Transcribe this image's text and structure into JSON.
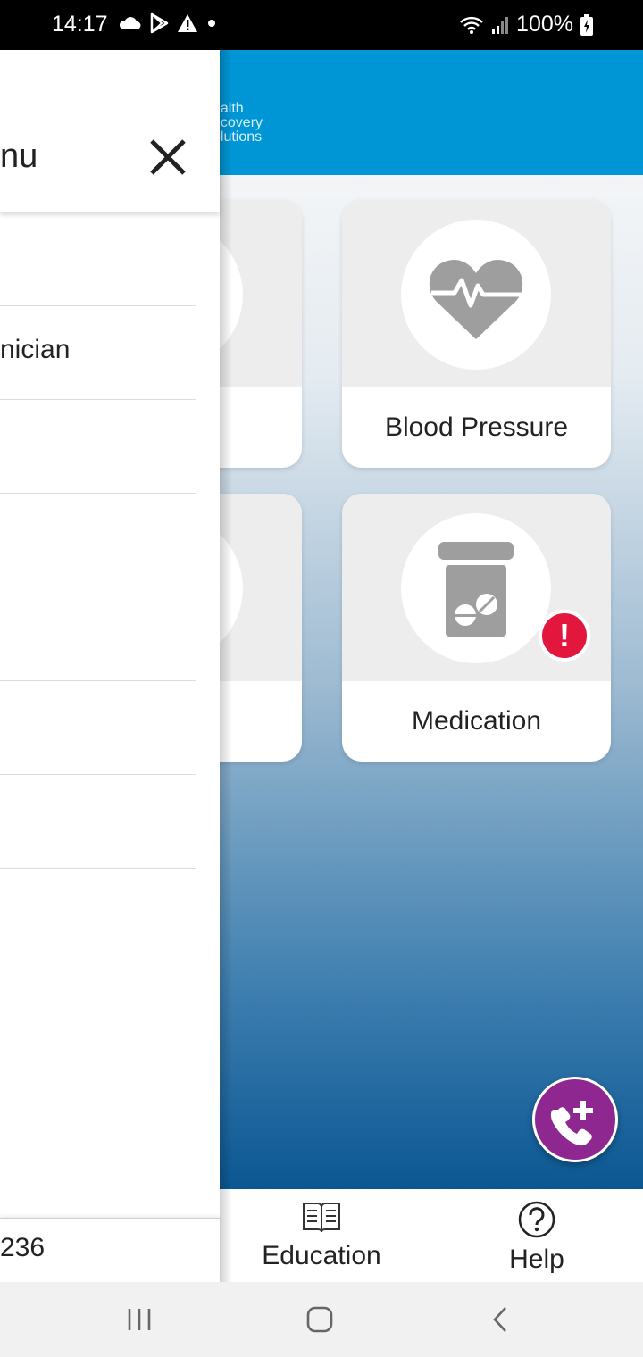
{
  "status_bar": {
    "time": "14:17",
    "battery": "100%",
    "icons": [
      "cloud-icon",
      "play-store-icon",
      "warning-icon",
      "dot-icon",
      "wifi-icon",
      "signal-icon",
      "battery-charging-icon"
    ]
  },
  "header": {
    "logo_line1": "ealth",
    "logo_line2": "ecovery",
    "logo_line3": "olutions"
  },
  "tiles": [
    {
      "label": "",
      "icon": "partial-icon"
    },
    {
      "label": "Blood Pressure",
      "icon": "heart-pulse-icon"
    },
    {
      "label": "",
      "icon": "partial-icon"
    },
    {
      "label": "Medication",
      "icon": "pill-bottle-icon",
      "alert": "!"
    }
  ],
  "fab": {
    "icon": "call-plus-icon"
  },
  "bottom_nav": {
    "education_label": "Education",
    "help_label": "Help"
  },
  "drawer": {
    "title": "nu",
    "items": [
      "",
      "nician",
      "",
      "",
      "",
      "",
      ""
    ],
    "footer": "236"
  },
  "colors": {
    "header_blue": "#0096d6",
    "fab_purple": "#8e278f",
    "alert_red": "#e3173e",
    "icon_gray": "#9e9e9e"
  }
}
